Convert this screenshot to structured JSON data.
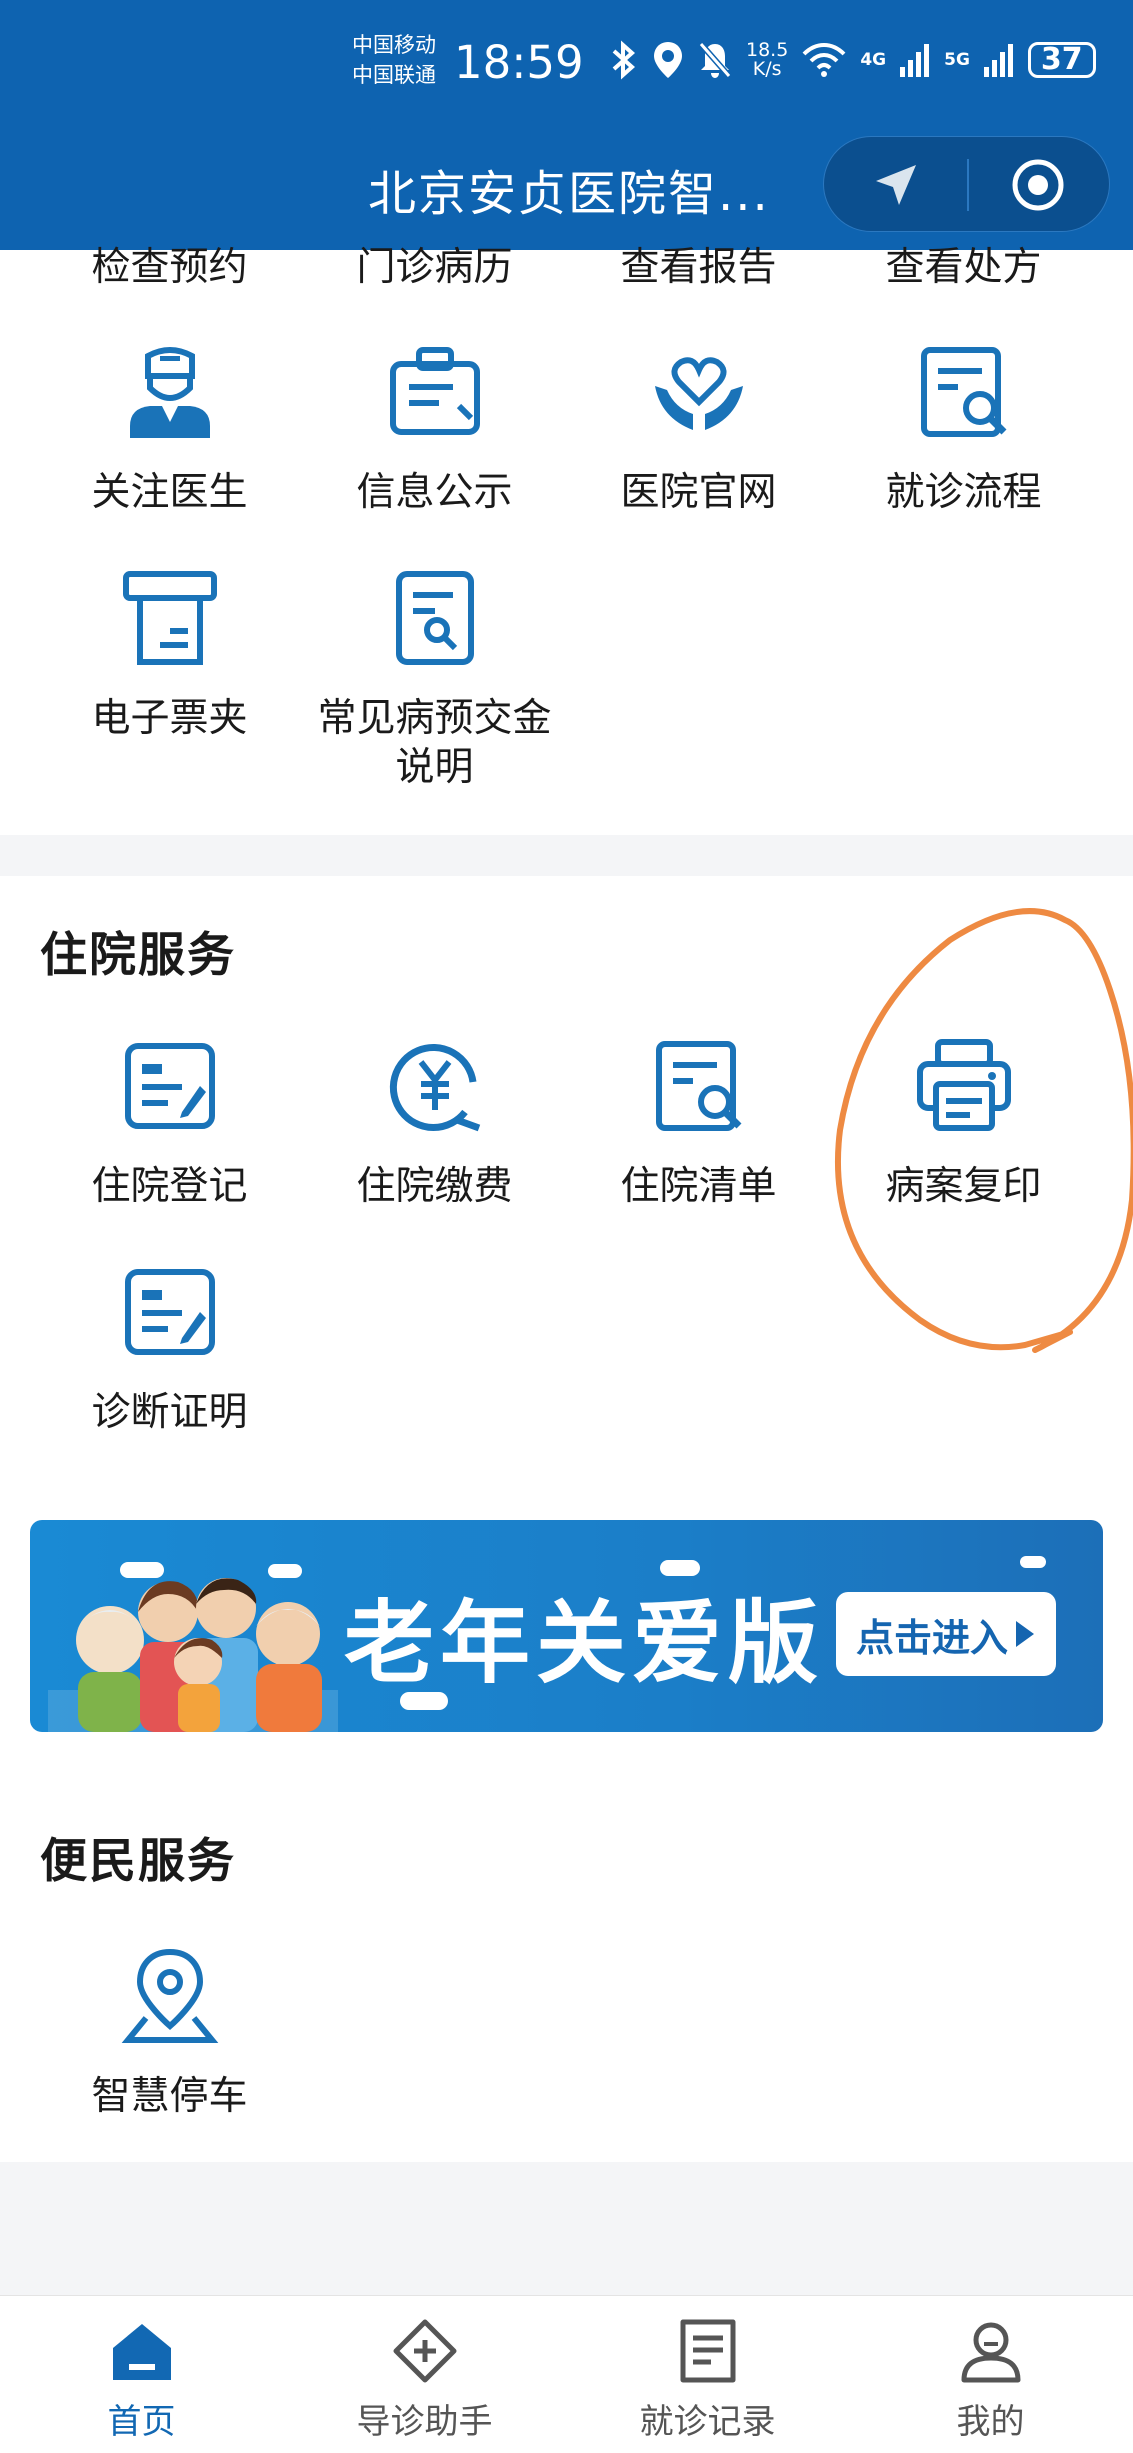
{
  "status_bar": {
    "carrier_1": "中国移动",
    "carrier_2": "中国联通",
    "time": "18:59",
    "speed_value": "18.5",
    "speed_unit": "K/s",
    "net_a": "4G",
    "net_b": "5G",
    "battery": "37"
  },
  "header": {
    "title": "北京安贞医院智..."
  },
  "outpatient": {
    "partial_row": [
      "检查预约",
      "门诊病历",
      "查看报告",
      "查看处方"
    ],
    "tiles": [
      {
        "label": "关注医生",
        "icon": "doctor-icon"
      },
      {
        "label": "信息公示",
        "icon": "notice-board-icon"
      },
      {
        "label": "医院官网",
        "icon": "heart-hands-icon"
      },
      {
        "label": "就诊流程",
        "icon": "document-search-icon"
      },
      {
        "label": "电子票夹",
        "icon": "receipt-printer-icon"
      },
      {
        "label_line1": "常见病预交金",
        "label_line2": "说明",
        "icon": "document-search-icon"
      }
    ]
  },
  "inpatient": {
    "title": "住院服务",
    "tiles": [
      {
        "label": "住院登记",
        "icon": "form-edit-icon"
      },
      {
        "label": "住院缴费",
        "icon": "yuan-payment-icon"
      },
      {
        "label": "住院清单",
        "icon": "document-search-icon"
      },
      {
        "label": "病案复印",
        "icon": "printer-icon"
      },
      {
        "label": "诊断证明",
        "icon": "form-edit-icon"
      }
    ]
  },
  "banner": {
    "title": "老年关爱版",
    "button": "点击进入"
  },
  "convenience": {
    "title": "便民服务",
    "tiles": [
      {
        "label": "智慧停车",
        "icon": "location-pin-icon"
      }
    ]
  },
  "bottom_nav": {
    "items": [
      {
        "label": "首页",
        "icon": "home-icon"
      },
      {
        "label": "导诊助手",
        "icon": "medical-guide-icon"
      },
      {
        "label": "就诊记录",
        "icon": "records-icon"
      },
      {
        "label": "我的",
        "icon": "user-icon"
      }
    ],
    "active": "首页"
  },
  "colors": {
    "header": "#0e63b0",
    "icon": "#1a73b8",
    "annotation": "#ee8a42"
  }
}
